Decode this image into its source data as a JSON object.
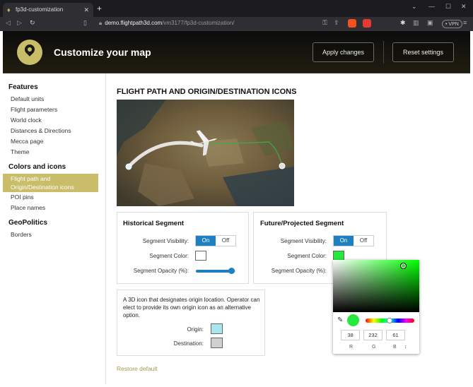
{
  "browser": {
    "tab_title": "fp3d-customization",
    "tab_close": "✕",
    "new_tab": "+",
    "url_host": "demo.flightpath3d.com",
    "url_path": "/vm3177/fp3d-customization/",
    "vpn_label": "• VPN",
    "win_min": "—",
    "win_max": "☐",
    "win_close": "✕",
    "win_chevron": "⌄"
  },
  "header": {
    "title": "Customize your map",
    "apply_label": "Apply changes",
    "reset_label": "Reset settings"
  },
  "sidebar": {
    "groups": [
      {
        "title": "Features",
        "items": [
          "Default units",
          "Flight parameters",
          "World clock",
          "Distances & Directions",
          "Mecca page",
          "Theme"
        ]
      },
      {
        "title": "Colors and icons",
        "items": [
          "Flight path and Origin/Destination icons",
          "POI pins",
          "Place names"
        ]
      },
      {
        "title": "GeoPolitics",
        "items": [
          "Borders"
        ]
      }
    ]
  },
  "main": {
    "section_title": "FLIGHT PATH AND ORIGIN/DESTINATION ICONS",
    "historical": {
      "title": "Historical Segment",
      "visibility_label": "Segment Visibility:",
      "on": "On",
      "off": "Off",
      "color_label": "Segment Color:",
      "color": "#ffffff",
      "opacity_label": "Segment Opacity (%):",
      "opacity": 0.9
    },
    "future": {
      "title": "Future/Projected Segment",
      "visibility_label": "Segment Visibility:",
      "on": "On",
      "off": "Off",
      "color_label": "Segment Color:",
      "color": "#26e83d",
      "opacity_label": "Segment Opacity (%):"
    },
    "icons": {
      "description": "A 3D icon that designates origin location. Operator can elect to provide its own origin icon as an alternative option.",
      "origin_label": "Origin:",
      "origin_color": "#a8e6ee",
      "destination_label": "Destination:",
      "destination_color": "#d0d0d0"
    },
    "restore_label": "Restore default"
  },
  "picker": {
    "r": "38",
    "g": "232",
    "b": "61",
    "r_label": "R",
    "g_label": "G",
    "b_label": "B",
    "mode_toggle": "↕"
  },
  "colors": {
    "accent": "#c9bd6a",
    "primary": "#1e7fc1"
  }
}
